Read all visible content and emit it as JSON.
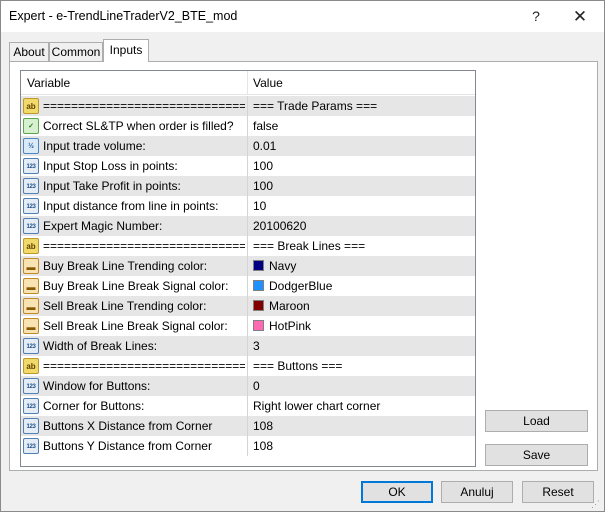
{
  "window": {
    "title": "Expert - e-TrendLineTraderV2_BTE_mod",
    "help_glyph": "?",
    "close_glyph": "✕"
  },
  "tabs": [
    {
      "label": "About"
    },
    {
      "label": "Common"
    },
    {
      "label": "Inputs",
      "active": true
    }
  ],
  "grid": {
    "headers": {
      "variable": "Variable",
      "value": "Value"
    },
    "rows": [
      {
        "icon": "ab",
        "name": "=================================...",
        "value": "=== Trade Params ==="
      },
      {
        "icon": "bool",
        "name": "Correct SL&TP when order is filled?",
        "value": "false"
      },
      {
        "icon": "dbl",
        "name": "Input trade volume:",
        "value": "0.01"
      },
      {
        "icon": "int",
        "name": "Input Stop Loss in points:",
        "value": "100"
      },
      {
        "icon": "int",
        "name": "Input Take Profit in points:",
        "value": "100"
      },
      {
        "icon": "int",
        "name": "Input distance from line in points:",
        "value": "10"
      },
      {
        "icon": "int",
        "name": "Expert Magic Number:",
        "value": "20100620"
      },
      {
        "icon": "ab",
        "name": "=================================...",
        "value": "=== Break Lines ==="
      },
      {
        "icon": "clr",
        "name": "Buy Break Line Trending color:",
        "value": "Navy",
        "color": "#000080"
      },
      {
        "icon": "clr",
        "name": "Buy Break Line Break Signal color:",
        "value": "DodgerBlue",
        "color": "#1e90ff"
      },
      {
        "icon": "clr",
        "name": "Sell Break Line Trending color:",
        "value": "Maroon",
        "color": "#800000"
      },
      {
        "icon": "clr",
        "name": "Sell Break Line Break Signal color:",
        "value": "HotPink",
        "color": "#ff69b4"
      },
      {
        "icon": "int",
        "name": "Width of Break Lines:",
        "value": "3"
      },
      {
        "icon": "ab",
        "name": "=================================...",
        "value": "=== Buttons ==="
      },
      {
        "icon": "int",
        "name": "Window for Buttons:",
        "value": "0"
      },
      {
        "icon": "int",
        "name": "Corner for Buttons:",
        "value": "Right lower chart corner"
      },
      {
        "icon": "int",
        "name": "Buttons X Distance from Corner",
        "value": "108"
      },
      {
        "icon": "int",
        "name": "Buttons Y Distance from Corner",
        "value": "108"
      }
    ]
  },
  "icon_glyphs": {
    "ab": "ab",
    "bool": "✓",
    "dbl": "½",
    "int": "123",
    "clr": "▬"
  },
  "icon_names": {
    "ab": "string-type-icon",
    "bool": "bool-type-icon",
    "dbl": "double-type-icon",
    "int": "integer-type-icon",
    "clr": "color-type-icon"
  },
  "side_buttons": {
    "load": "Load",
    "save": "Save"
  },
  "footer_buttons": {
    "ok": "OK",
    "cancel": "Anuluj",
    "reset": "Reset"
  }
}
